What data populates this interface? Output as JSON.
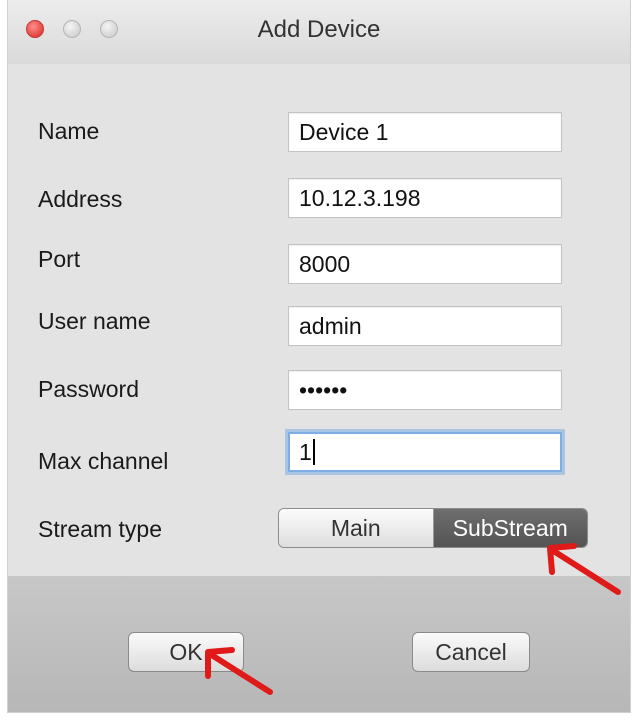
{
  "window": {
    "title": "Add Device"
  },
  "form": {
    "name": {
      "label": "Name",
      "value": "Device 1"
    },
    "address": {
      "label": "Address",
      "value": "10.12.3.198"
    },
    "port": {
      "label": "Port",
      "value": "8000"
    },
    "username": {
      "label": "User name",
      "value": "admin"
    },
    "password": {
      "label": "Password",
      "value": "••••••"
    },
    "max_channel": {
      "label": "Max channel",
      "value": "1"
    },
    "stream_type": {
      "label": "Stream type",
      "options": [
        "Main",
        "SubStream"
      ],
      "selected": "SubStream"
    }
  },
  "buttons": {
    "ok": "OK",
    "cancel": "Cancel"
  },
  "icons": {
    "close": "close-light-icon",
    "minimize": "minimize-light-icon",
    "zoom": "zoom-light-icon",
    "annotation": "red-arrow-icon"
  },
  "colors": {
    "close_light": "#e3433d",
    "focus_ring": "#7eaee6",
    "selected_segment": "#5f5f5f",
    "annotation_arrow": "#e01919"
  }
}
